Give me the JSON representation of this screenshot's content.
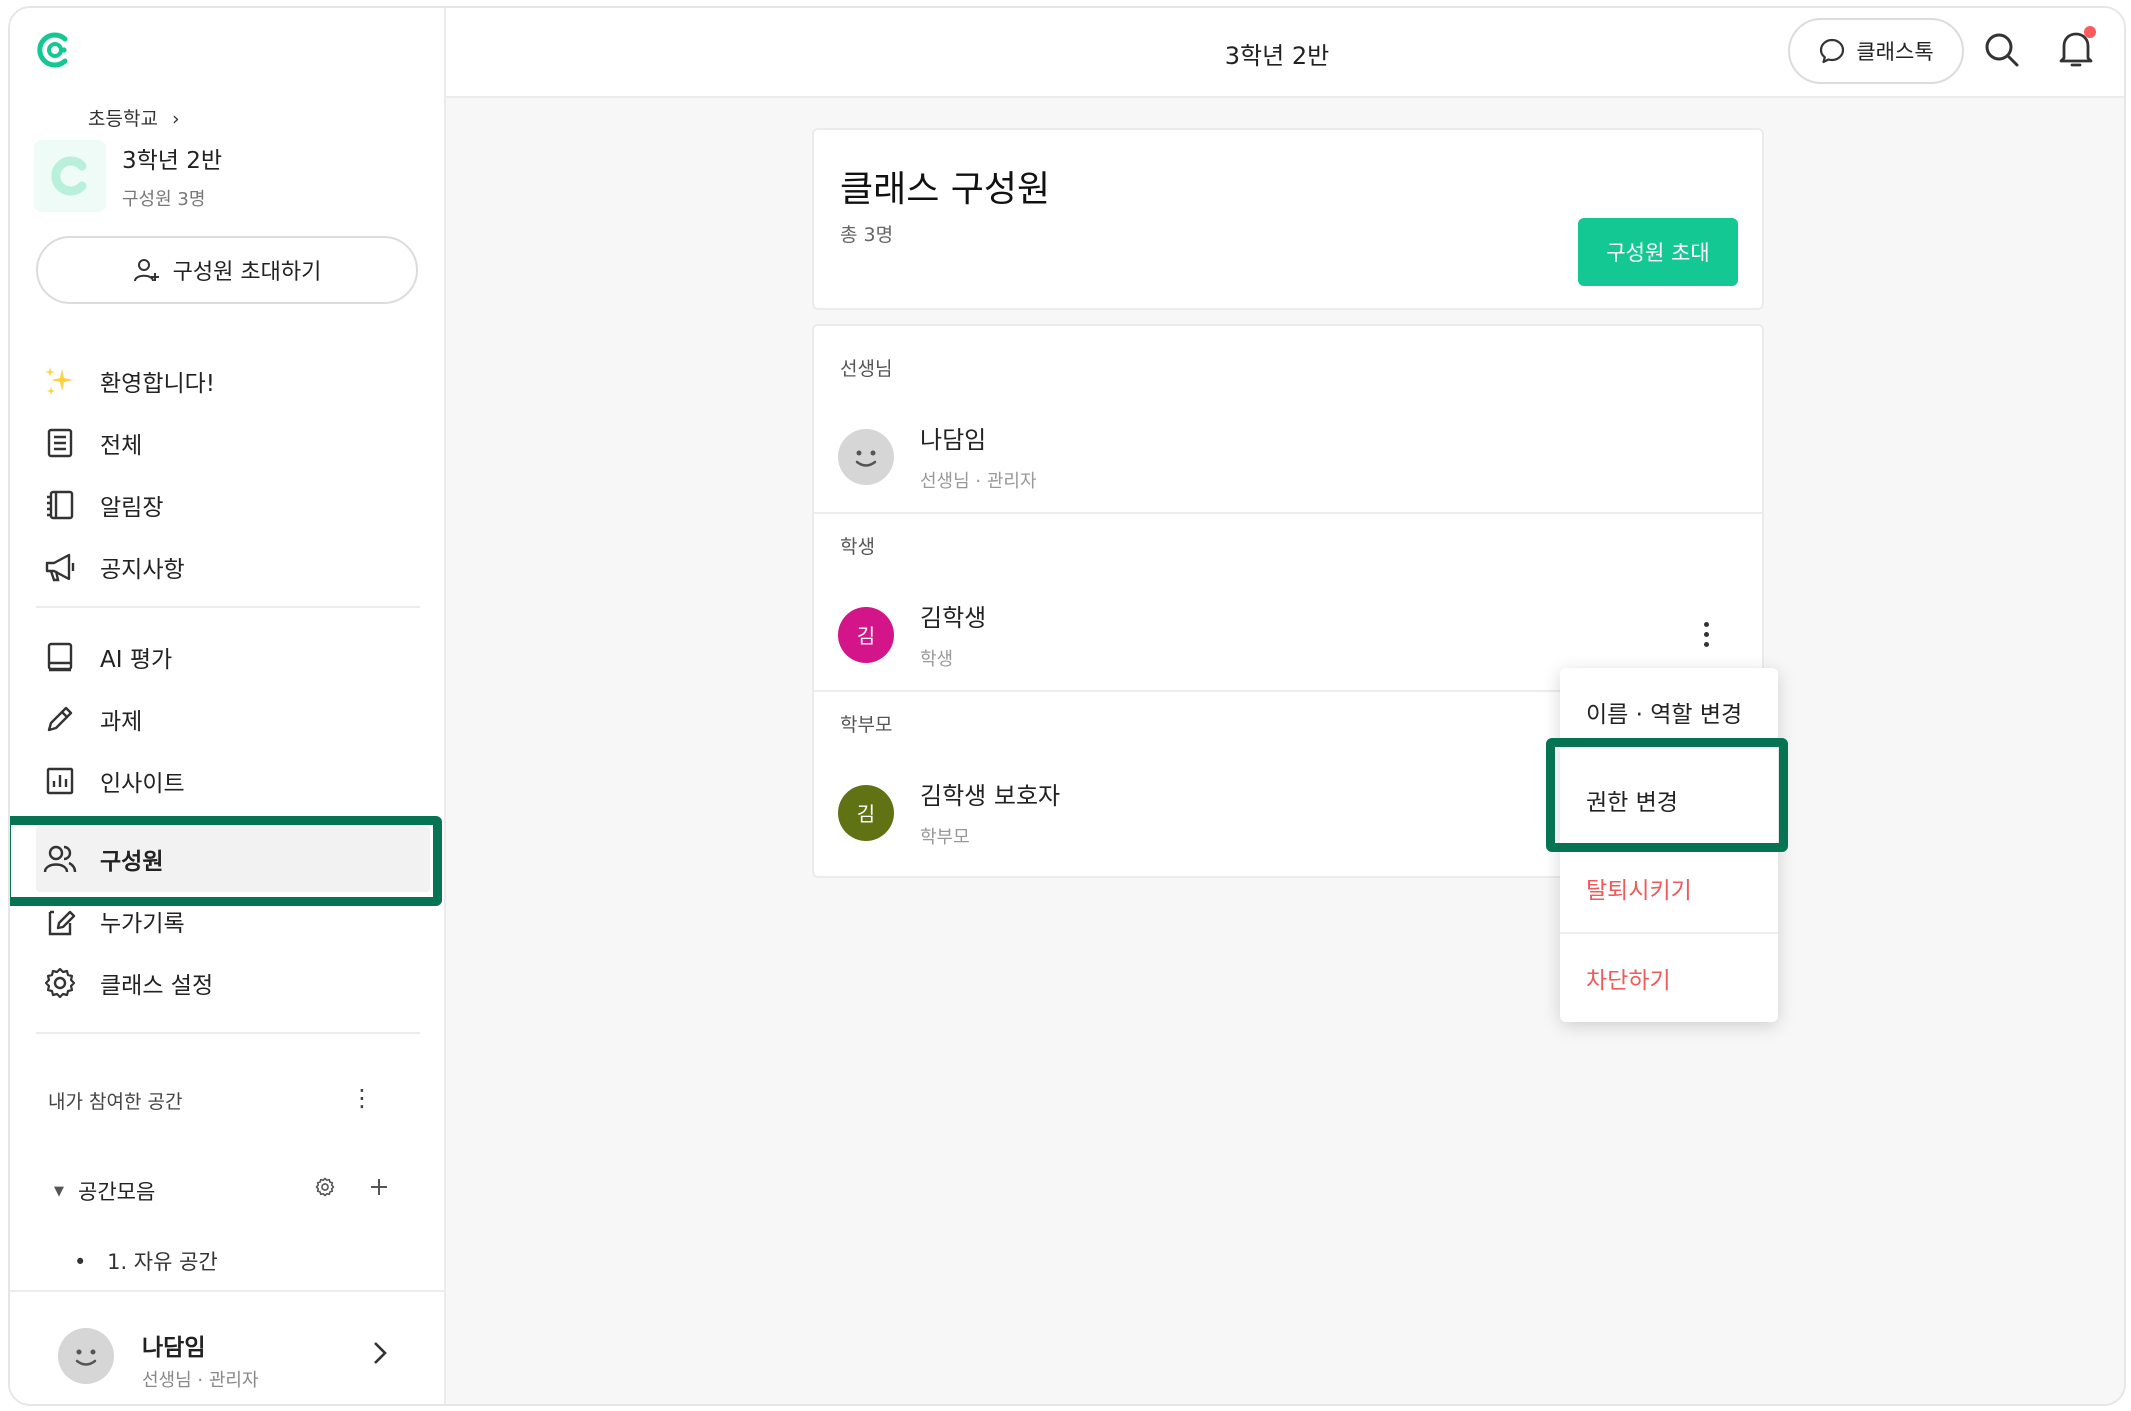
{
  "colors": {
    "brand": "#14c894",
    "highlight": "#067353",
    "danger": "#f05a5a"
  },
  "sidebar": {
    "school": "초등학교",
    "class_name": "3학년 2반",
    "class_members": "구성원 3명",
    "invite_label": "구성원 초대하기",
    "nav_group1": [
      {
        "label": "환영합니다!",
        "icon": "sparkle-icon"
      },
      {
        "label": "전체",
        "icon": "document-icon"
      },
      {
        "label": "알림장",
        "icon": "notebook-icon"
      },
      {
        "label": "공지사항",
        "icon": "megaphone-icon"
      }
    ],
    "nav_group2": [
      {
        "label": "AI 평가",
        "icon": "book-icon"
      },
      {
        "label": "과제",
        "icon": "pencil-icon"
      },
      {
        "label": "인사이트",
        "icon": "chart-icon"
      }
    ],
    "nav_group3": [
      {
        "label": "구성원",
        "icon": "people-icon",
        "active": true
      },
      {
        "label": "누가기록",
        "icon": "edit-note-icon"
      },
      {
        "label": "클래스 설정",
        "icon": "gear-icon"
      }
    ],
    "my_spaces_title": "내가 참여한 공간",
    "space_group": "공간모음",
    "space_item": "1. 자유 공간",
    "user": {
      "name": "나담임",
      "role": "선생님 · 관리자"
    }
  },
  "header": {
    "title": "3학년 2반",
    "classtalk_label": "클래스톡"
  },
  "main": {
    "title": "클래스 구성원",
    "total": "총 3명",
    "invite_button": "구성원 초대",
    "groups": {
      "teacher": "선생님",
      "student": "학생",
      "parent": "학부모"
    },
    "members": [
      {
        "name": "나담임",
        "role": "선생님 · 관리자",
        "avatar": "",
        "color": "#d6d6d6"
      },
      {
        "name": "김학생",
        "role": "학생",
        "avatar": "김",
        "color": "#d4158a"
      },
      {
        "name": "김학생 보호자",
        "role": "학부모",
        "avatar": "김",
        "color": "#5f7315"
      }
    ]
  },
  "menu": {
    "items": [
      {
        "label": "이름 · 역할 변경"
      },
      {
        "label": "권한 변경"
      },
      {
        "label": "탈퇴시키기"
      },
      {
        "label": "차단하기"
      }
    ]
  }
}
